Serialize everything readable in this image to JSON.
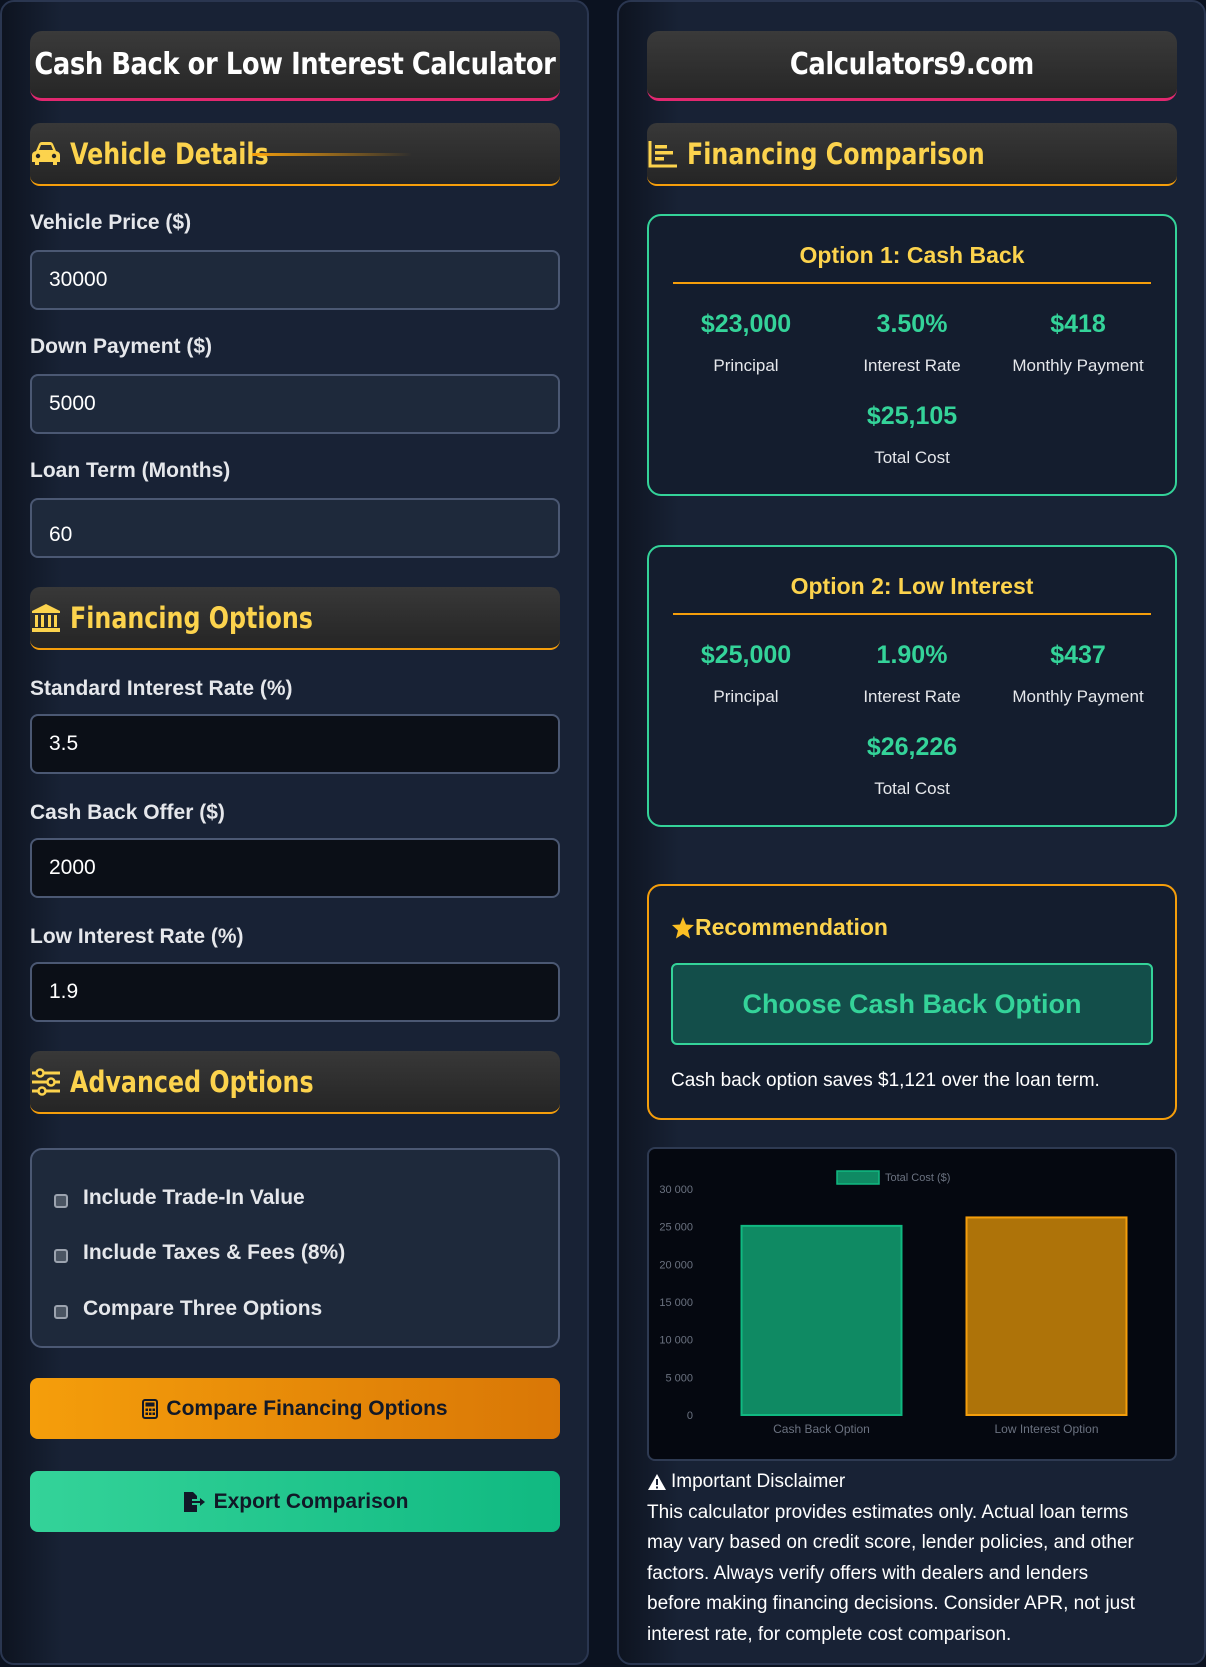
{
  "left": {
    "title": "Cash Back or Low Interest Calculator",
    "vehicle_details": {
      "heading": "Vehicle Details",
      "price_label": "Vehicle Price ($)",
      "price_value": "30000",
      "down_label": "Down Payment ($)",
      "down_value": "5000",
      "term_label": "Loan Term (Months)",
      "term_value": "60"
    },
    "financing_options": {
      "heading": "Financing Options",
      "std_rate_label": "Standard Interest Rate (%)",
      "std_rate_value": "3.5",
      "cashback_label": "Cash Back Offer ($)",
      "cashback_value": "2000",
      "low_rate_label": "Low Interest Rate (%)",
      "low_rate_value": "1.9"
    },
    "advanced": {
      "heading": "Advanced Options",
      "options": [
        "Include Trade-In Value",
        "Include Taxes & Fees (8%)",
        "Compare Three Options"
      ]
    },
    "compare_button": "Compare Financing Options",
    "export_button": "Export Comparison"
  },
  "right": {
    "title": "Calculators9.com",
    "heading": "Financing Comparison",
    "option1": {
      "title": "Option 1: Cash Back",
      "principal": "$23,000",
      "principal_label": "Principal",
      "rate": "3.50%",
      "rate_label": "Interest Rate",
      "monthly": "$418",
      "monthly_label": "Monthly Payment",
      "total": "$25,105",
      "total_label": "Total Cost"
    },
    "option2": {
      "title": "Option 2: Low Interest",
      "principal": "$25,000",
      "principal_label": "Principal",
      "rate": "1.90%",
      "rate_label": "Interest Rate",
      "monthly": "$437",
      "monthly_label": "Monthly Payment",
      "total": "$26,226",
      "total_label": "Total Cost"
    },
    "recommendation": {
      "title": "Recommendation",
      "choice": "Choose Cash Back Option",
      "text": "Cash back option saves $1,121 over the loan term."
    },
    "disclaimer": {
      "title": "Important Disclaimer",
      "lines": [
        "This calculator provides estimates only. Actual loan terms",
        "may vary based on credit score, lender policies, and other",
        "factors. Always verify offers with dealers and lenders",
        "before making financing decisions. Consider APR, not just",
        "interest rate, for complete cost comparison."
      ]
    }
  },
  "colors": {
    "accent_gold": "#fcd34d",
    "accent_orange": "#f59e0b",
    "accent_green": "#34d399",
    "accent_pink": "#e2286f"
  },
  "chart_data": {
    "type": "bar",
    "categories": [
      "Cash Back Option",
      "Low Interest Option"
    ],
    "series": [
      {
        "name": "Total Cost ($)",
        "values": [
          25105,
          26226
        ]
      }
    ],
    "ylim": [
      0,
      30000
    ],
    "yticks": [
      "0",
      "5 000",
      "10 000",
      "15 000",
      "20 000",
      "25 000",
      "30 000"
    ],
    "bar_colors": [
      "#0f8a63",
      "#ae7309"
    ],
    "bar_borders": [
      "#10b981",
      "#f59e0b"
    ],
    "legend": "top",
    "grid": false
  }
}
